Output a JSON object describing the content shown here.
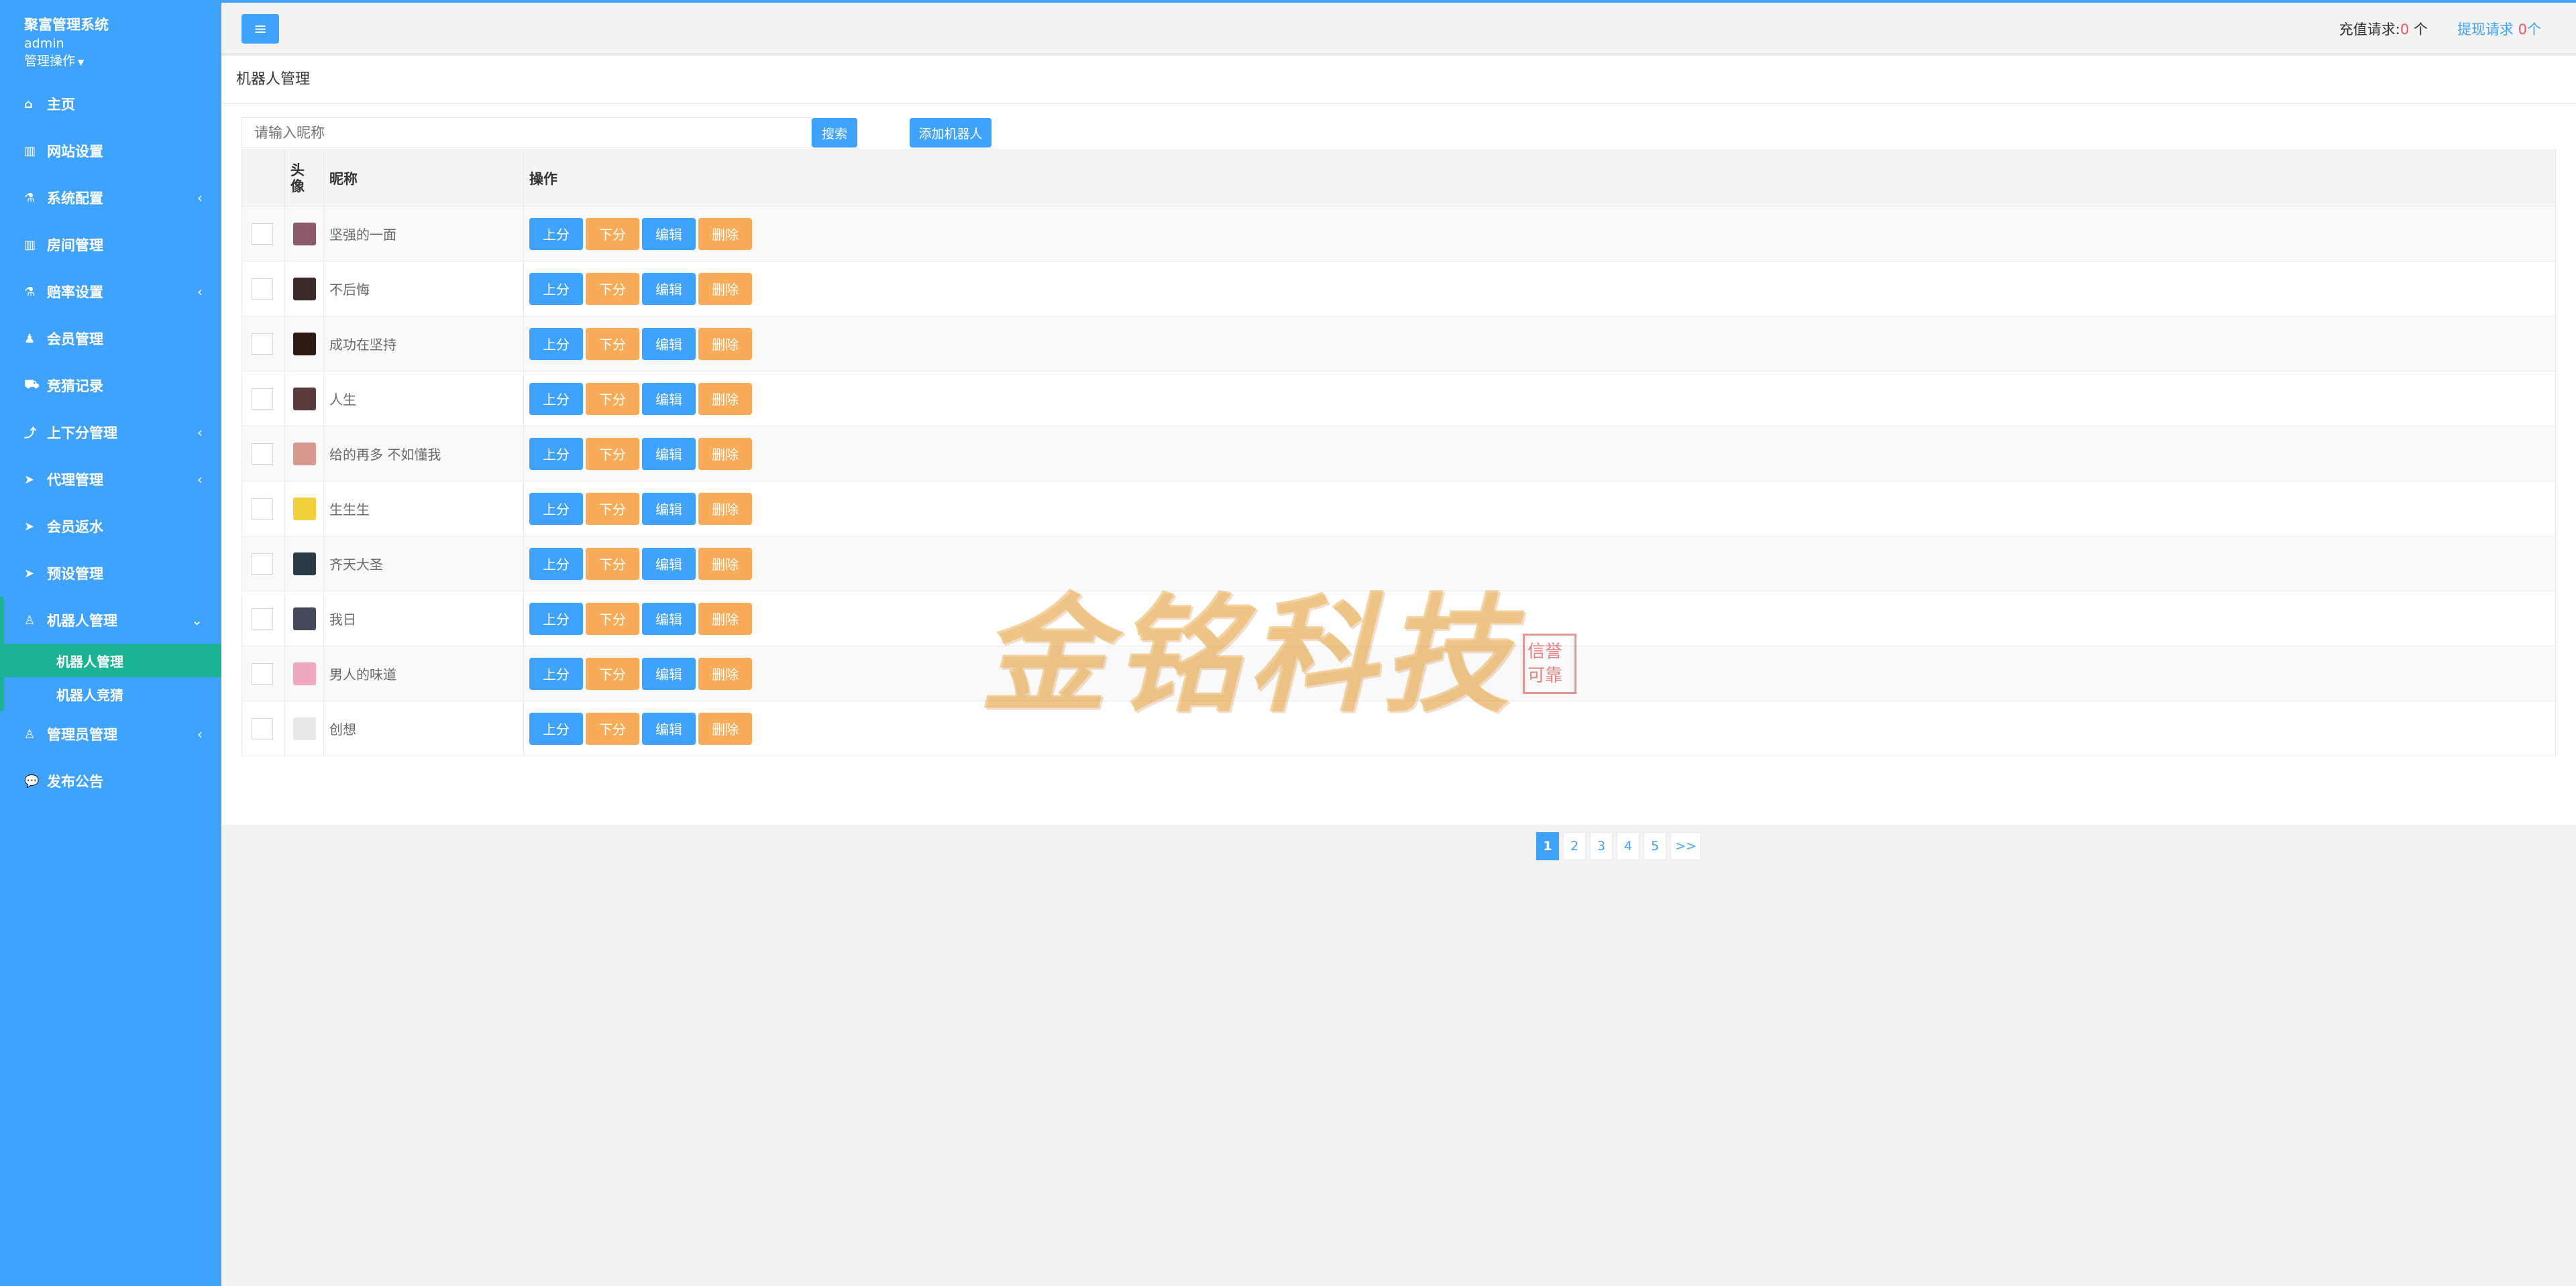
{
  "sidebar": {
    "title": "聚富管理系统",
    "user": "admin",
    "ops_label": "管理操作",
    "items": [
      {
        "label": "主页",
        "icon": "home-icon",
        "glyph": "⌂",
        "arrow": ""
      },
      {
        "label": "网站设置",
        "icon": "columns-icon",
        "glyph": "▥",
        "arrow": ""
      },
      {
        "label": "系统配置",
        "icon": "flask-icon",
        "glyph": "⚗",
        "arrow": "‹"
      },
      {
        "label": "房间管理",
        "icon": "columns-icon",
        "glyph": "▥",
        "arrow": ""
      },
      {
        "label": "赔率设置",
        "icon": "flask-icon",
        "glyph": "⚗",
        "arrow": "‹"
      },
      {
        "label": "会员管理",
        "icon": "user-icon",
        "glyph": "♟",
        "arrow": ""
      },
      {
        "label": "竞猜记录",
        "icon": "car-icon",
        "glyph": "⛟",
        "arrow": ""
      },
      {
        "label": "上下分管理",
        "icon": "level-up-icon",
        "glyph": "⤴",
        "arrow": "‹"
      },
      {
        "label": "代理管理",
        "icon": "paper-plane-icon",
        "glyph": "➤",
        "arrow": "‹"
      },
      {
        "label": "会员返水",
        "icon": "paper-plane-icon",
        "glyph": "➤",
        "arrow": ""
      },
      {
        "label": "预设管理",
        "icon": "paper-plane-icon",
        "glyph": "➤",
        "arrow": ""
      },
      {
        "label": "机器人管理",
        "icon": "male-icon",
        "glyph": "♙",
        "arrow": "⌄"
      },
      {
        "label": "管理员管理",
        "icon": "male-icon",
        "glyph": "♙",
        "arrow": "‹"
      },
      {
        "label": "发布公告",
        "icon": "comment-icon",
        "glyph": "💬",
        "arrow": ""
      }
    ],
    "subitems": [
      {
        "label": "机器人管理"
      },
      {
        "label": "机器人竞猜"
      }
    ]
  },
  "topbar": {
    "menu_glyph": "≡",
    "recharge_label": "充值请求:",
    "recharge_count": "0",
    "recharge_unit": " 个",
    "withdraw_label": "提现请求",
    "withdraw_count": "0",
    "withdraw_unit": "个"
  },
  "panel": {
    "title": "机器人管理",
    "search_placeholder": "请输入昵称",
    "search_button": "搜索",
    "add_button": "添加机器人"
  },
  "table": {
    "headers": {
      "avatar": "头像",
      "name": "昵称",
      "ops": "操作"
    },
    "op_labels": {
      "up": "上分",
      "down": "下分",
      "edit": "编辑",
      "delete": "删除"
    },
    "rows": [
      {
        "name": "坚强的一面",
        "avatar_color": "#8b5a6b"
      },
      {
        "name": "不后悔",
        "avatar_color": "#3a2a2a"
      },
      {
        "name": "成功在坚持",
        "avatar_color": "#2c1b12"
      },
      {
        "name": "人生",
        "avatar_color": "#5a3b3b"
      },
      {
        "name": "给的再多 不如懂我",
        "avatar_color": "#d89a8e"
      },
      {
        "name": "生生生",
        "avatar_color": "#f2d23c"
      },
      {
        "name": "齐天大圣",
        "avatar_color": "#2a3a44"
      },
      {
        "name": "我日",
        "avatar_color": "#444a5a"
      },
      {
        "name": "男人的味道",
        "avatar_color": "#f0a8c0"
      },
      {
        "name": "创想",
        "avatar_color": "#e8e8e8"
      }
    ]
  },
  "pagination": {
    "pages": [
      "1",
      "2",
      "3",
      "4",
      "5"
    ],
    "next": ">>",
    "current": "1"
  },
  "watermark": {
    "text": "金铭科技",
    "seal": "信誉可靠"
  },
  "colors": {
    "primary": "#3fa2fd",
    "accent": "#1ab394",
    "warning": "#f8ac59",
    "danger": "#ed5565"
  }
}
